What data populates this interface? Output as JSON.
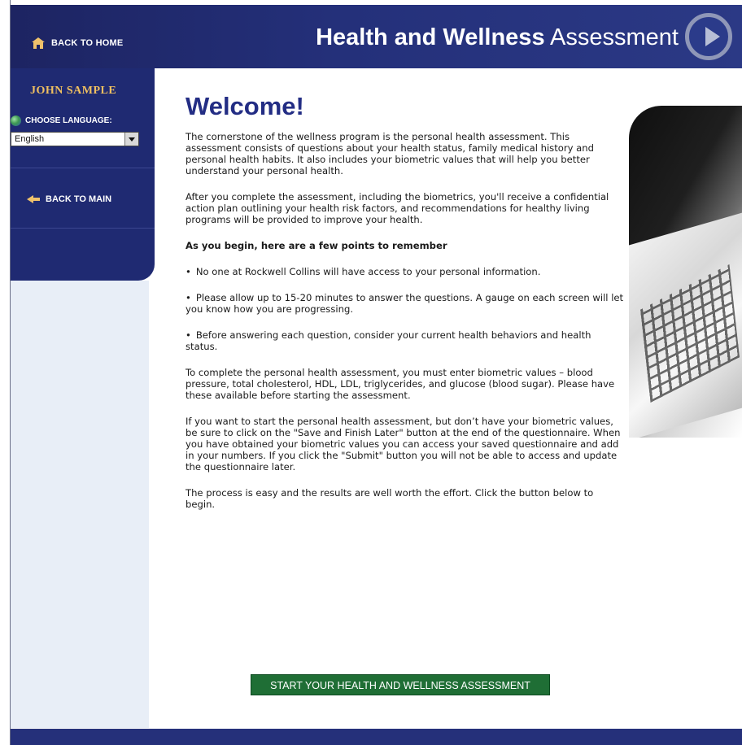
{
  "header": {
    "back_home_label": "BACK TO HOME",
    "title_bold": "Health and Wellness",
    "title_light": "Assessment"
  },
  "sidebar": {
    "user_name": "JOHN SAMPLE",
    "choose_language_label": "CHOOSE LANGUAGE:",
    "language_value": "English",
    "back_main_label": "BACK TO MAIN"
  },
  "main": {
    "welcome": "Welcome!",
    "paragraph_1": "The cornerstone of the wellness program is the personal health assessment. This assessment consists of questions about your health status, family medical history and personal health habits. It also includes your biometric values that will help you better understand your personal health.",
    "paragraph_2": "After you complete the assessment, including the biometrics, you'll receive a confidential action plan outlining your health risk factors, and recommendations for healthy living programs will be provided to improve your health.",
    "points_heading": "As you begin, here are a few points to remember",
    "bullets": [
      "No one at Rockwell Collins will have access to your personal information.",
      "Please allow up to 15-20 minutes to answer the questions. A gauge on each screen will let you know how you are progressing.",
      "Before answering each question, consider your current health behaviors and health status."
    ],
    "paragraph_3": "To complete the personal health assessment, you must enter biometric values – blood pressure, total cholesterol, HDL, LDL, triglycerides, and glucose (blood sugar). Please have these available before starting the assessment.",
    "paragraph_4": "If you want to start the personal health assessment, but don’t have your biometric values, be sure to click on the \"Save and Finish Later\" button at the end of the questionnaire. When you have obtained your biometric values you can access your saved questionnaire and add in your numbers. If you click the \"Submit\" button you will not be able to access and update the questionnaire later.",
    "paragraph_5": "The process is easy and the results are well worth the effort. Click the button below to begin.",
    "start_button_label": "START YOUR HEALTH AND WELLNESS ASSESSMENT"
  }
}
